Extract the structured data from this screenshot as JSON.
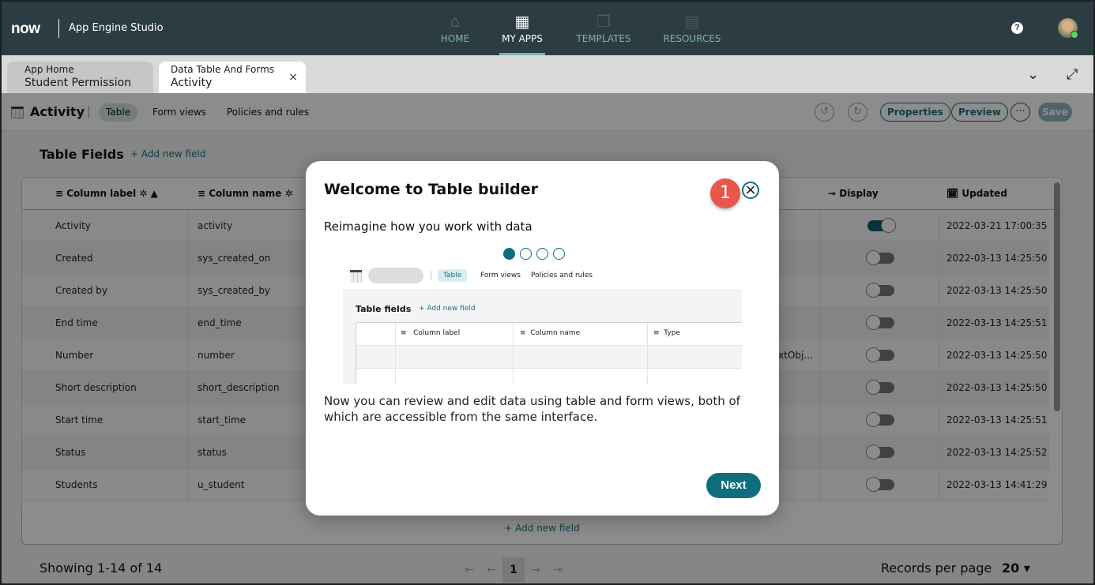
{
  "header": {
    "logo": "now",
    "app_name": "App Engine Studio",
    "nav": [
      {
        "label": "HOME",
        "icon": "home-icon"
      },
      {
        "label": "MY APPS",
        "icon": "grid-icon",
        "active": true
      },
      {
        "label": "TEMPLATES",
        "icon": "templates-icon"
      },
      {
        "label": "RESOURCES",
        "icon": "resources-icon"
      }
    ],
    "help": "?"
  },
  "tabs": [
    {
      "line1": "App Home",
      "line2": "Student Permission"
    },
    {
      "line1": "Data Table And Forms",
      "line2": "Activity",
      "close": "×"
    }
  ],
  "toolbar": {
    "title": "Activity",
    "tabs": [
      "Table",
      "Form views",
      "Policies and rules"
    ],
    "properties": "Properties",
    "preview": "Preview",
    "more": "···",
    "save": "Save"
  },
  "fields": {
    "title": "Table Fields",
    "add": "+  Add new field",
    "columns": {
      "label": "Column label",
      "name": "Column name",
      "display": "Display",
      "updated": "Updated"
    },
    "rows": [
      {
        "label": "Activity",
        "name": "activity",
        "extra": "",
        "display": true,
        "updated": "2022-03-21 17:00:35"
      },
      {
        "label": "Created",
        "name": "sys_created_on",
        "extra": "",
        "display": false,
        "updated": "2022-03-13 14:25:50"
      },
      {
        "label": "Created by",
        "name": "sys_created_by",
        "extra": "",
        "display": false,
        "updated": "2022-03-13 14:25:50"
      },
      {
        "label": "End time",
        "name": "end_time",
        "extra": "",
        "display": false,
        "updated": "2022-03-13 14:25:51"
      },
      {
        "label": "Number",
        "name": "number",
        "extra": "extObj...",
        "display": false,
        "updated": "2022-03-13 14:25:50"
      },
      {
        "label": "Short description",
        "name": "short_description",
        "extra": "",
        "display": false,
        "updated": "2022-03-13 14:25:50"
      },
      {
        "label": "Start time",
        "name": "start_time",
        "extra": "",
        "display": false,
        "updated": "2022-03-13 14:25:51"
      },
      {
        "label": "Status",
        "name": "status",
        "extra": "",
        "display": false,
        "updated": "2022-03-13 14:25:52"
      },
      {
        "label": "Students",
        "name": "u_student",
        "extra": "",
        "display": false,
        "updated": "2022-03-13 14:41:29"
      }
    ],
    "add_bottom": "+   Add new field"
  },
  "footer": {
    "showing": "Showing 1-14 of 14",
    "page": "1",
    "records_label": "Records per page",
    "records_value": "20 ▾"
  },
  "modal": {
    "title": "Welcome to Table builder",
    "badge": "1",
    "subtitle": "Reimagine how you work with data",
    "steps": 4,
    "current_step": 1,
    "illustration": {
      "tabs": [
        "Table",
        "Form views",
        "Policies and rules"
      ],
      "title": "Table fields",
      "add": "+ Add new field",
      "columns": [
        "Column label",
        "Column name",
        "Type"
      ]
    },
    "description": "Now you can review and edit data using table and form views, both of which are accessible from the same interface.",
    "next": "Next"
  },
  "colors": {
    "header": "#2b3d42",
    "accent": "#0f6e7e",
    "badge": "#e8574b"
  }
}
